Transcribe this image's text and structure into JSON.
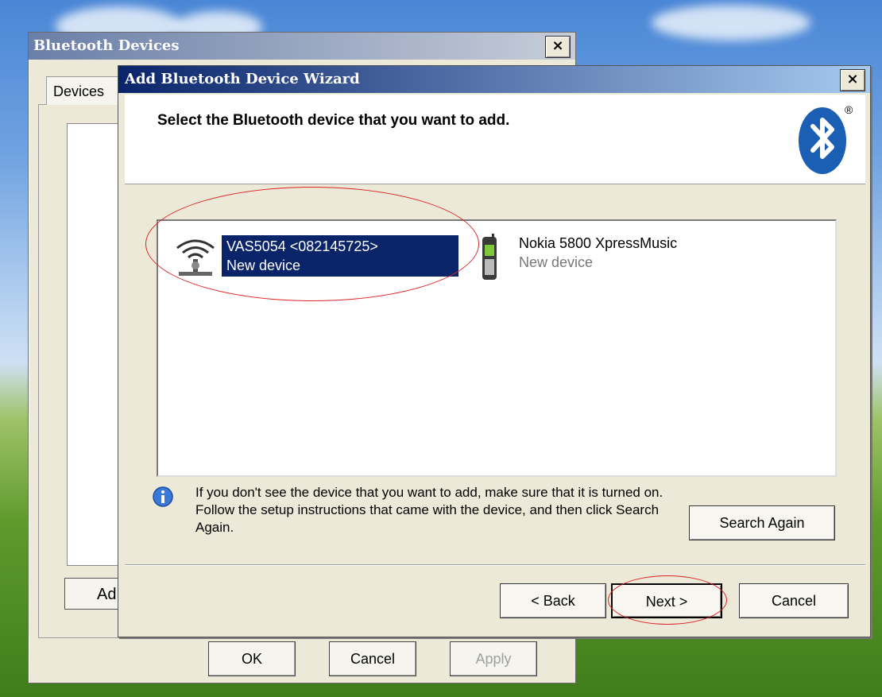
{
  "back_dialog": {
    "title": "Bluetooth Devices",
    "close_label": "×",
    "tab_label": "Devices",
    "add_label": "Ad",
    "buttons": {
      "ok": "OK",
      "cancel": "Cancel",
      "apply": "Apply"
    }
  },
  "wizard": {
    "title": "Add Bluetooth Device Wizard",
    "close_label": "×",
    "heading": "Select the Bluetooth device that you want to add.",
    "logo": "bluetooth-logo",
    "registered_mark": "®",
    "devices": [
      {
        "name": "VAS5054 <082145725>",
        "status": "New device",
        "icon": "wireless-tower-icon",
        "selected": true
      },
      {
        "name": "Nokia 5800 XpressMusic",
        "status": "New device",
        "icon": "phone-icon",
        "selected": false
      }
    ],
    "info_text": "If you don't see the device that you want to add, make sure that it is turned on. Follow the setup instructions that came with the device, and then click Search Again.",
    "search_again_label": "Search Again",
    "back_label": "< Back",
    "next_label": "Next >",
    "cancel_label": "Cancel",
    "highlight_color": "#0a246a",
    "annotation_color": "#d22222"
  }
}
